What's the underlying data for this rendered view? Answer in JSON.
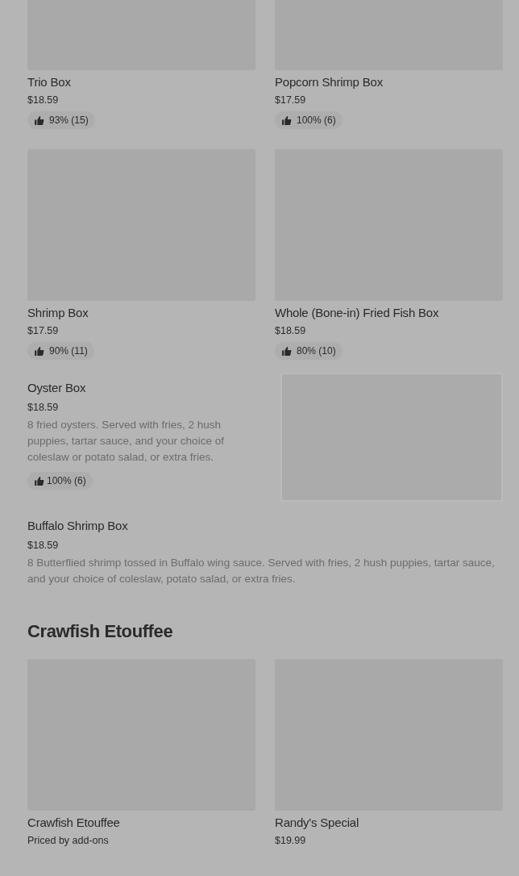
{
  "blocks": [
    {
      "kind": "grid",
      "items": [
        {
          "title": "Trio Box",
          "price": "$18.59",
          "rating": "93% (15)"
        },
        {
          "title": "Popcorn Shrimp Box",
          "price": "$17.59",
          "rating": "100% (6)"
        },
        {
          "title": "Shrimp Box",
          "price": "$17.59",
          "rating": "90% (11)"
        },
        {
          "title": "Whole (Bone-in) Fried Fish Box",
          "price": "$18.59",
          "rating": "80% (10)"
        }
      ]
    },
    {
      "kind": "row",
      "title": "Oyster Box",
      "price": "$18.59",
      "description": "8 fried oysters. Served with fries, 2 hush puppies, tartar sauce, and your choice of coleslaw or potato salad, or extra fries.",
      "rating": "100% (6)",
      "image": true
    },
    {
      "kind": "row",
      "title": "Buffalo Shrimp Box",
      "price": "$18.59",
      "description": "8 Butterflied shrimp tossed in Buffalo wing sauce. Served with fries, 2 hush puppies, tartar sauce, and your choice of coleslaw, potato salad, or extra fries.",
      "image": false
    },
    {
      "kind": "heading",
      "title": "Crawfish Etouffee"
    },
    {
      "kind": "grid",
      "items": [
        {
          "title": "Crawfish Etouffee",
          "price": "Priced by add-ons"
        },
        {
          "title": "Randy's Special",
          "price": "$19.99"
        }
      ]
    }
  ]
}
